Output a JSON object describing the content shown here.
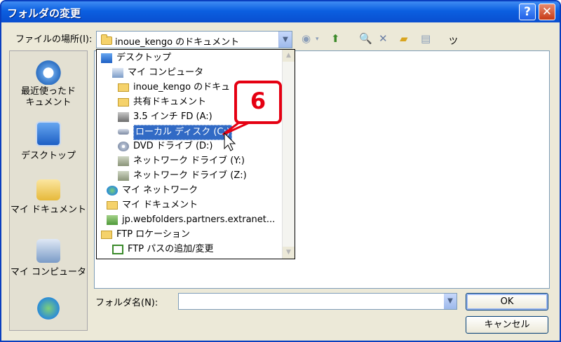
{
  "window": {
    "title": "フォルダの変更",
    "help": "?",
    "close": "✕"
  },
  "lookin": {
    "label": "ファイルの場所(I):",
    "value": "inoue_kengo のドキュメント"
  },
  "toolbar": {
    "tools_label": "ツール(L) ▾"
  },
  "places": [
    {
      "label": "最近使ったド\nキュメント",
      "icon": "recent-docs-icon"
    },
    {
      "label": "デスクトップ",
      "icon": "desktop-icon"
    },
    {
      "label": "マイ ドキュメント",
      "icon": "my-documents-icon"
    },
    {
      "label": "マイ コンピュータ",
      "icon": "my-computer-icon"
    },
    {
      "label": "",
      "icon": "network-places-icon"
    }
  ],
  "dropdown": {
    "items": [
      {
        "label": "デスクトップ",
        "icon": "desktop-icon"
      },
      {
        "label": "マイ コンピュータ",
        "icon": "my-computer-icon"
      },
      {
        "label": "inoue_kengo のドキュ",
        "icon": "folder-icon"
      },
      {
        "label": "共有ドキュメント",
        "icon": "folder-icon"
      },
      {
        "label": "3.5 インチ FD (A:)",
        "icon": "floppy-icon"
      },
      {
        "label": "ローカル ディスク (C:)",
        "icon": "hard-disk-icon",
        "selected": true
      },
      {
        "label": "DVD ドライブ (D:)",
        "icon": "dvd-icon"
      },
      {
        "label": "ネットワーク ドライブ (Y:)",
        "icon": "network-drive-icon"
      },
      {
        "label": "ネットワーク ドライブ (Z:)",
        "icon": "network-drive-icon"
      },
      {
        "label": "マイ ネットワーク",
        "icon": "network-icon"
      },
      {
        "label": "マイ ドキュメント",
        "icon": "folder-icon"
      },
      {
        "label": "jp.webfolders.partners.extranet...",
        "icon": "webfolder-icon"
      },
      {
        "label": "FTP ロケーション",
        "icon": "folder-icon"
      },
      {
        "label": "FTP パスの追加/変更",
        "icon": "ftp-add-icon"
      }
    ]
  },
  "callout": {
    "number": "6"
  },
  "folder_name": {
    "label": "フォルダ名(N):",
    "value": ""
  },
  "buttons": {
    "ok": "OK",
    "cancel": "キャンセル"
  },
  "colors": {
    "selection": "#316ac5",
    "callout": "#e50012",
    "titlebar": "#0b5fe0"
  }
}
